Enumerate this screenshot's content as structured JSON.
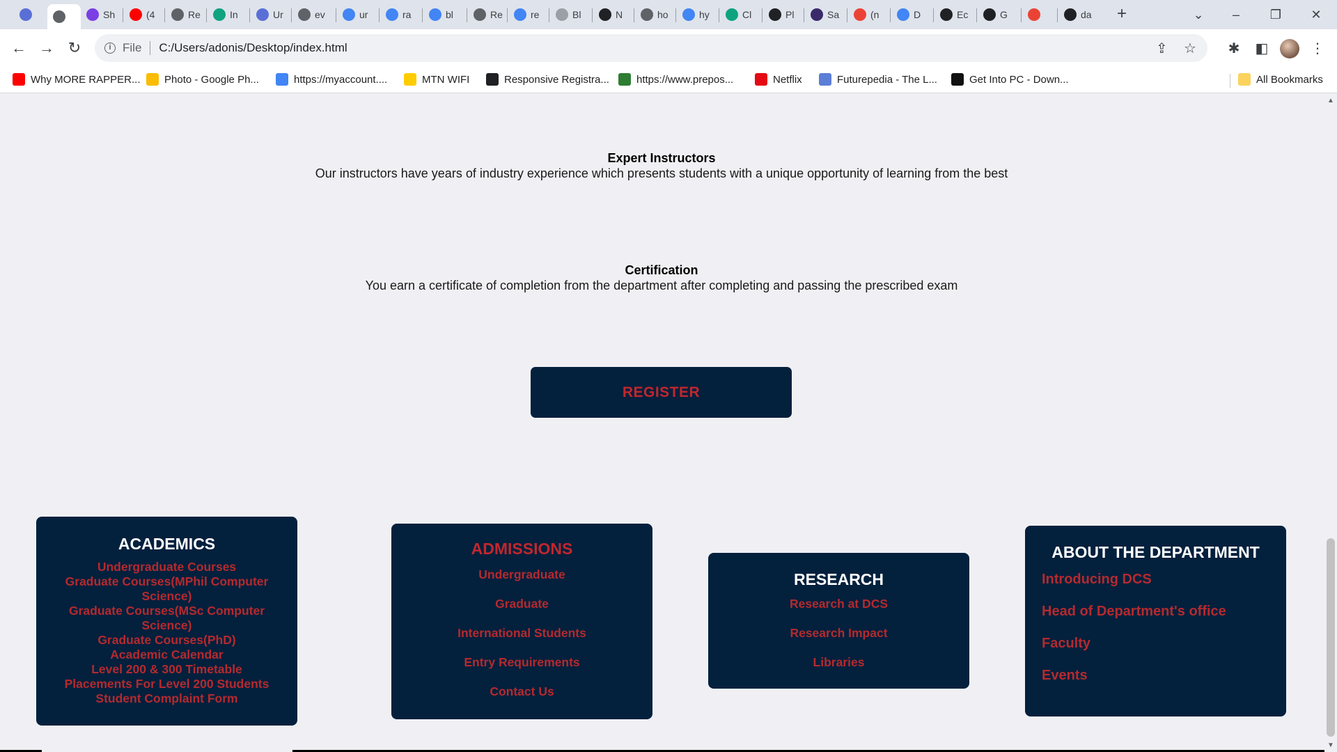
{
  "browser": {
    "tabs": [
      {
        "label": "",
        "icon": "dcs-site-icon",
        "color": "#5a6fd6"
      },
      {
        "label": "",
        "icon": "globe-icon",
        "color": "#5f6368",
        "active": true
      },
      {
        "label": "Sh",
        "icon": "list-icon",
        "color": "#7b3fe4"
      },
      {
        "label": "(4",
        "icon": "youtube-icon",
        "color": "#ff0000"
      },
      {
        "label": "Re",
        "icon": "globe-icon",
        "color": "#5f6368"
      },
      {
        "label": "In",
        "icon": "openai-icon",
        "color": "#10a37f"
      },
      {
        "label": "Ur",
        "icon": "dcs-site-icon",
        "color": "#5a6fd6"
      },
      {
        "label": "ev",
        "icon": "globe-icon",
        "color": "#5f6368"
      },
      {
        "label": "ur",
        "icon": "google-icon",
        "color": "#4285f4"
      },
      {
        "label": "ra",
        "icon": "google-icon",
        "color": "#4285f4"
      },
      {
        "label": "bl",
        "icon": "google-icon",
        "color": "#4285f4"
      },
      {
        "label": "Re",
        "icon": "globe-icon",
        "color": "#5f6368"
      },
      {
        "label": "re",
        "icon": "google-icon",
        "color": "#4285f4"
      },
      {
        "label": "Bl",
        "icon": "dots-icon",
        "color": "#9aa0a6"
      },
      {
        "label": "N",
        "icon": "notion-icon",
        "color": "#202124"
      },
      {
        "label": "ho",
        "icon": "globe-icon",
        "color": "#5f6368"
      },
      {
        "label": "hy",
        "icon": "google-icon",
        "color": "#4285f4"
      },
      {
        "label": "Cl",
        "icon": "openai-icon",
        "color": "#10a37f"
      },
      {
        "label": "Pl",
        "icon": "github-icon",
        "color": "#202124"
      },
      {
        "label": "Sa",
        "icon": "shield-icon",
        "color": "#3a2a6a"
      },
      {
        "label": "(n",
        "icon": "gmail-icon",
        "color": "#ea4335"
      },
      {
        "label": "D",
        "icon": "docs-icon",
        "color": "#4285f4"
      },
      {
        "label": "Ec",
        "icon": "github-icon",
        "color": "#202124"
      },
      {
        "label": "G",
        "icon": "github-icon",
        "color": "#202124"
      },
      {
        "label": "",
        "icon": "gmail-icon",
        "color": "#ea4335"
      },
      {
        "label": "da",
        "icon": "github-icon",
        "color": "#202124"
      }
    ],
    "address": {
      "scheme_label": "File",
      "url": "C:/Users/adonis/Desktop/index.html"
    },
    "bookmarks": [
      {
        "label": "Why MORE RAPPER...",
        "icon": "youtube-icon",
        "color": "#ff0000"
      },
      {
        "label": "Photo - Google Ph...",
        "icon": "google-photos-icon",
        "color": "#fbbc04"
      },
      {
        "label": "https://myaccount....",
        "icon": "google-icon",
        "color": "#4285f4"
      },
      {
        "label": "MTN WIFI",
        "icon": "mtn-icon",
        "color": "#ffcc00"
      },
      {
        "label": "Responsive Registra...",
        "icon": "globe-icon",
        "color": "#202124"
      },
      {
        "label": "https://www.prepos...",
        "icon": "prepostseo-icon",
        "color": "#2e7d32"
      },
      {
        "label": "Netflix",
        "icon": "netflix-icon",
        "color": "#e50914"
      },
      {
        "label": "Futurepedia - The L...",
        "icon": "futurepedia-icon",
        "color": "#5b7fd6"
      },
      {
        "label": "Get Into PC - Down...",
        "icon": "getintopc-icon",
        "color": "#111111"
      }
    ],
    "all_bookmarks_label": "All Bookmarks"
  },
  "page": {
    "features": [
      {
        "title": "Expert Instructors",
        "text": "Our instructors have years of industry experience which presents students with a unique opportunity of learning from the best"
      },
      {
        "title": "Certification",
        "text": "You earn a certificate of completion from the department after completing and passing the prescribed exam"
      }
    ],
    "register_label": "REGISTER",
    "footer": {
      "academics": {
        "title": "ACADEMICS",
        "links": [
          "Undergraduate Courses",
          "Graduate Courses(MPhil Computer Science)",
          "Graduate Courses(MSc Computer Science)",
          "Graduate Courses(PhD)",
          "Academic Calendar",
          "Level 200 & 300 Timetable",
          "Placements For Level 200 Students",
          "Student Complaint Form"
        ]
      },
      "admissions": {
        "title": "ADMISSIONS",
        "links": [
          "Undergraduate",
          "Graduate",
          "International Students",
          "Entry Requirements",
          "Contact Us"
        ]
      },
      "research": {
        "title": "RESEARCH",
        "links": [
          "Research at DCS",
          "Research Impact",
          "Libraries"
        ]
      },
      "about": {
        "title": "ABOUT THE DEPARTMENT",
        "links": [
          "Introducing DCS",
          "Head of Department's office",
          "Faculty",
          "Events"
        ]
      }
    }
  },
  "colors": {
    "card_bg": "#03203d",
    "link_red": "#b42a2e",
    "page_bg": "#f0f0f4"
  }
}
